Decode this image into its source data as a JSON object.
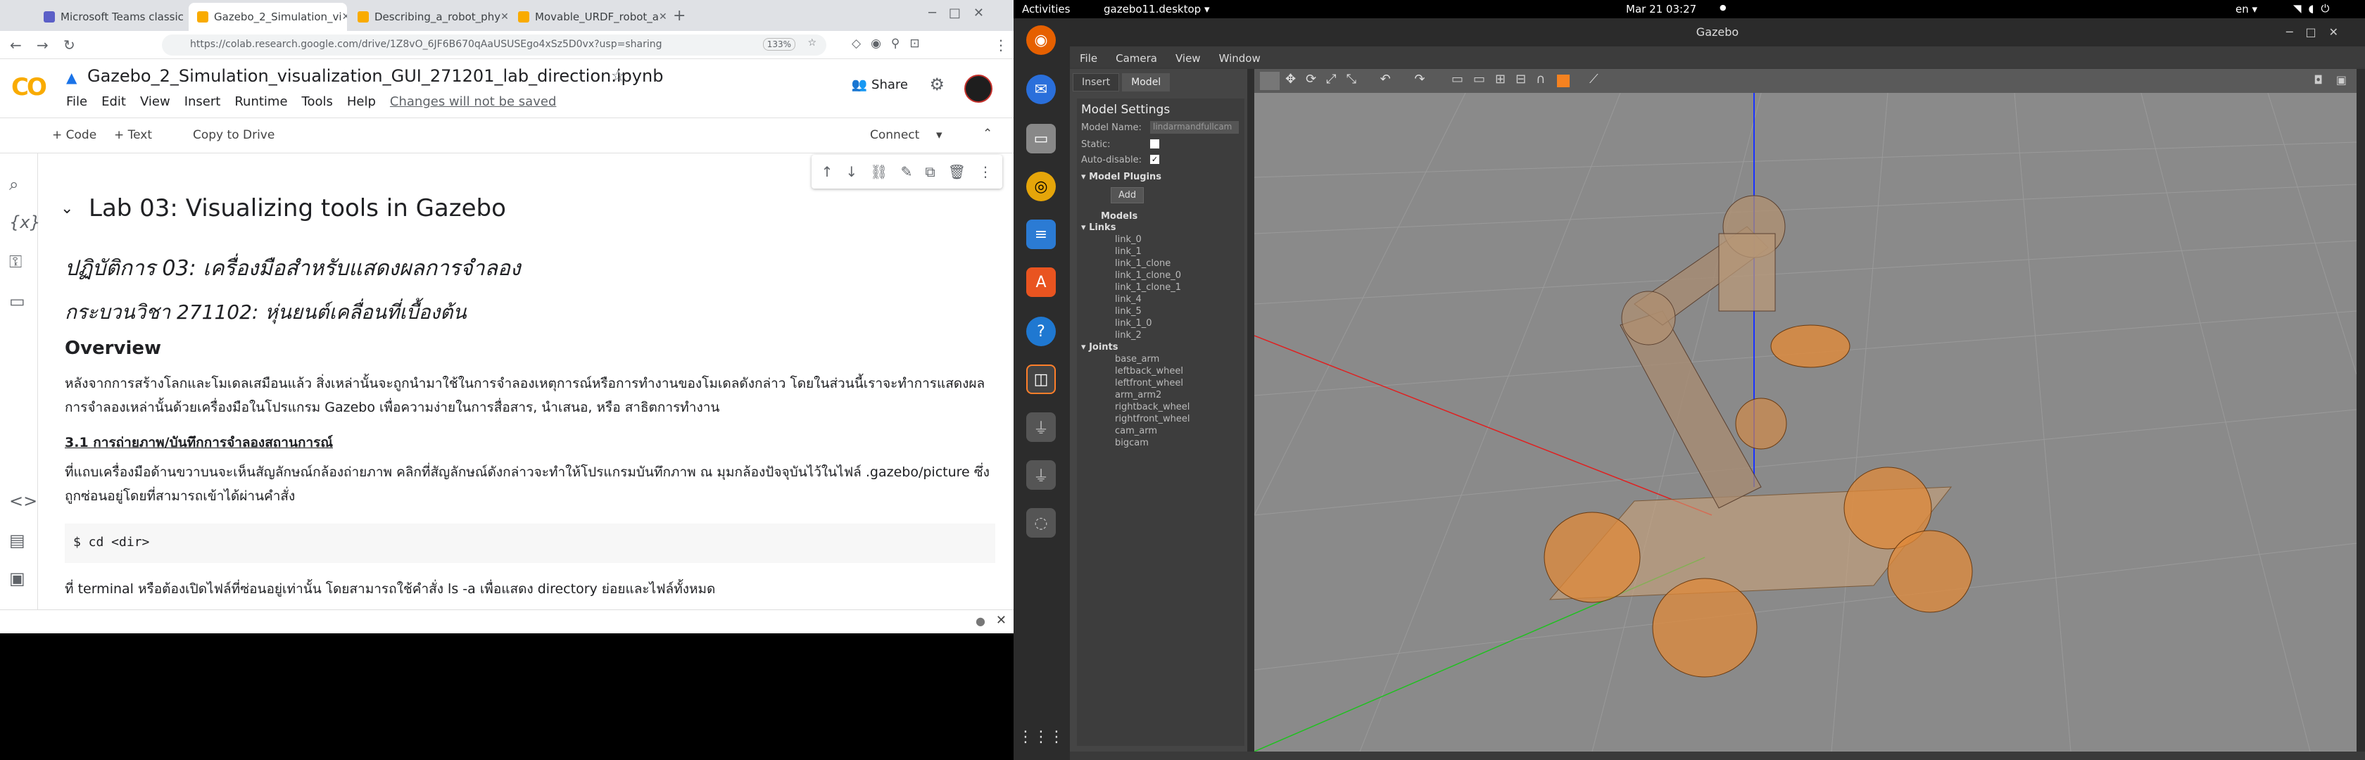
{
  "browser": {
    "tabs": [
      {
        "label": "Microsoft Teams classic",
        "color": "#5b5fc7"
      },
      {
        "label": "Gazebo_2_Simulation_vi",
        "color": "#f9ab00"
      },
      {
        "label": "Describing_a_robot_phy",
        "color": "#f9ab00"
      },
      {
        "label": "Movable_URDF_robot_a",
        "color": "#f9ab00"
      }
    ],
    "url": "https://colab.research.google.com/drive/1Z8vO_6JF6B670qAaUSUSEgo4xSz5D0vx?usp=sharing",
    "zoom": "133%"
  },
  "colab": {
    "logo": "CO",
    "title": "Gazebo_2_Simulation_visualization_GUI_271201_lab_direction.ipynb",
    "menu": [
      "File",
      "Edit",
      "View",
      "Insert",
      "Runtime",
      "Tools",
      "Help"
    ],
    "unsaved": "Changes will not be saved",
    "share": "Share",
    "toolbar": {
      "code": "+ Code",
      "text": "+ Text",
      "copy": "Copy to Drive",
      "connect": "Connect"
    }
  },
  "notebook": {
    "h1": "Lab 03: Visualizing tools in Gazebo",
    "h2": "ปฏิบัติการ 03: เครื่องมือสำหรับแสดงผลการจำลอง",
    "h3": "กระบวนวิชา 271102: หุ่นยนต์เคลื่อนที่เบื้องต้น",
    "overview": "Overview",
    "p1": "หลังจากการสร้างโลกและโมเดลเสมือนแล้ว สิ่งเหล่านั้นจะถูกนำมาใช้ในการจำลองเหตุการณ์หรือการทำงานของโมเดลดังกล่าว โดยในส่วนนี้เราจะทำการแสดงผลการจำลองเหล่านั้นด้วยเครื่องมือในโปรแกรม Gazebo เพื่อความง่ายในการสื่อสาร, นำเสนอ, หรือ สาธิตการทำงาน",
    "sec": "3.1 การถ่ายภาพ/บันทึกการจำลองสถานการณ์",
    "p2": "ที่แถบเครื่องมือด้านขวาบนจะเห็นสัญลักษณ์กล้องถ่ายภาพ คลิกที่สัญลักษณ์ดังกล่าวจะทำให้โปรแกรมบันทึกภาพ ณ มุมกล้องปัจจุบันไว้ในไฟล์ .gazebo/picture ซึ่งถูกซ่อนอยู่โดยที่สามารถเข้าได้ผ่านคำสั่ง",
    "code": "$ cd <dir>",
    "p3": "ที่ terminal หรือต้องเปิดไฟล์ที่ซ่อนอยู่เท่านั้น โดยสามารถใช้คำสั่ง ls -a เพื่อแสดง directory ย่อยและไฟล์ทั้งหมด"
  },
  "gnome": {
    "activities": "Activities",
    "app": "gazebo11.desktop ▾",
    "clock": "Mar 21  03:27",
    "lang": "en ▾"
  },
  "gazebo": {
    "title": "Gazebo",
    "menu": [
      "File",
      "Camera",
      "View",
      "Window"
    ],
    "tabs": [
      "Insert",
      "Model"
    ],
    "model_settings": "Model Settings",
    "model_name_label": "Model Name:",
    "model_name": "lindarmandfullcam",
    "static_label": "Static:",
    "autodisable_label": "Auto-disable:",
    "plugins": "Model Plugins",
    "add": "Add",
    "models": "Models",
    "links_label": "Links",
    "links": [
      "link_0",
      "link_1",
      "link_1_clone",
      "link_1_clone_0",
      "link_1_clone_1",
      "link_4",
      "link_5",
      "link_1_0",
      "link_2"
    ],
    "joints_label": "Joints",
    "joints": [
      "base_arm",
      "leftback_wheel",
      "leftfront_wheel",
      "arm_arm2",
      "rightback_wheel",
      "rightfront_wheel",
      "cam_arm",
      "bigcam"
    ]
  }
}
